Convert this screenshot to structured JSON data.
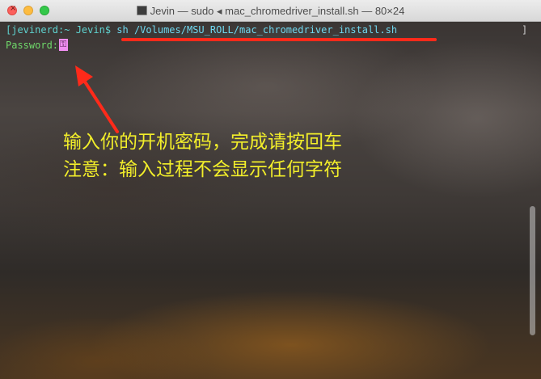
{
  "window": {
    "title": "Jevin — sudo ◂ mac_chromedriver_install.sh — 80×24"
  },
  "terminal": {
    "bracket_left": "[",
    "prompt": "jevinerd:~ Jevin$ ",
    "command": "sh /Volumes/MSU_ROLL/mac_chromedriver_install.sh",
    "bracket_right": "]",
    "password_label": "Password:",
    "cursor_glyph": "⚿"
  },
  "annotation": {
    "line1": "输入你的开机密码，完成请按回车",
    "line2": "注意：输入过程不会显示任何字符"
  },
  "colors": {
    "arrow": "#ff2a1a",
    "annotation_text": "#f2ee2a",
    "cursor": "#f08ff0"
  }
}
